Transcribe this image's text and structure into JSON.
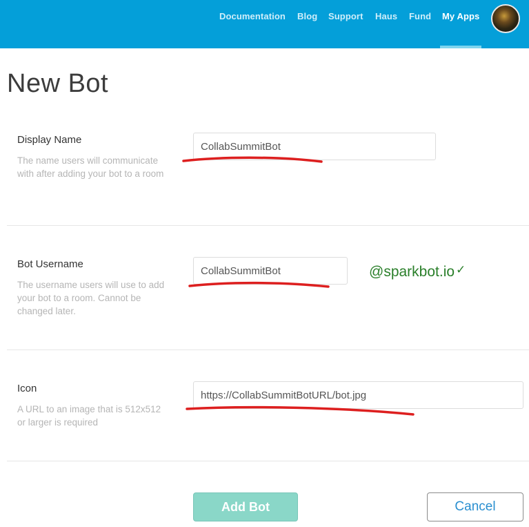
{
  "nav": {
    "items": [
      {
        "label": "Documentation",
        "active": false
      },
      {
        "label": "Blog",
        "active": false
      },
      {
        "label": "Support",
        "active": false
      },
      {
        "label": "Haus",
        "active": false
      },
      {
        "label": "Fund",
        "active": false
      },
      {
        "label": "My Apps",
        "active": true
      }
    ],
    "accent_color": "#049fd9"
  },
  "page": {
    "title": "New Bot"
  },
  "form": {
    "display_name": {
      "label": "Display Name",
      "help": "The name users will communicate with after adding your bot to a room",
      "value": "CollabSummitBot"
    },
    "bot_username": {
      "label": "Bot Username",
      "help": "The username users will use to add your bot to a room. Cannot be changed later.",
      "value": "CollabSummitBot",
      "suffix": "@sparkbot.io",
      "validated_icon": "check-icon"
    },
    "icon": {
      "label": "Icon",
      "help": "A URL to an image that is 512x512 or larger is required",
      "value": "https://CollabSummitBotURL/bot.jpg"
    }
  },
  "actions": {
    "add_label": "Add Bot",
    "cancel_label": "Cancel"
  }
}
